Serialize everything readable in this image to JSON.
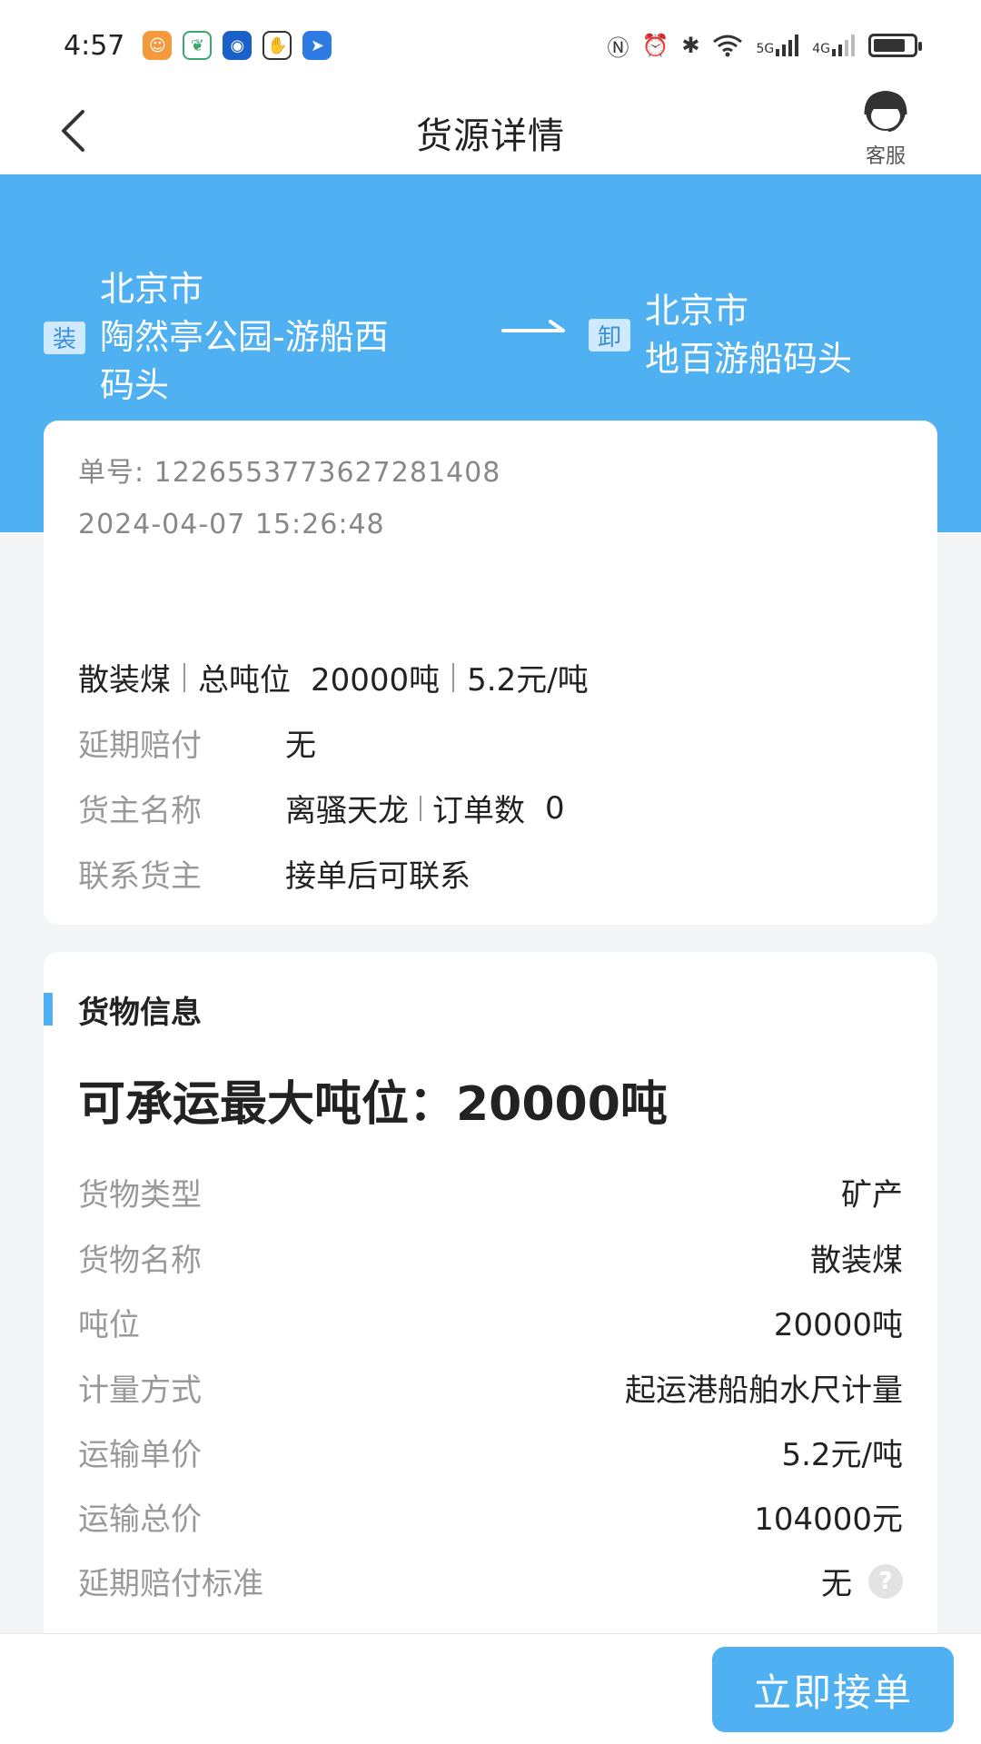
{
  "status": {
    "time": "4:57",
    "app_icons": [
      "taobao-icon",
      "leaf-app-icon",
      "robot-app-icon",
      "hand-app-icon",
      "arrow-app-icon"
    ],
    "system_icons": [
      "nfc-icon",
      "alarm-icon",
      "bluetooth-icon",
      "wifi-icon",
      "signal-5g-icon",
      "signal-4g-icon",
      "battery-icon"
    ],
    "net1": "5G",
    "net2": "4G"
  },
  "nav": {
    "title": "货源详情",
    "service_label": "客服"
  },
  "route": {
    "load_tag": "装",
    "from_city": "北京市",
    "from_place_line1": "陶然亭公园-游船西",
    "from_place_line2": "码头",
    "unload_tag": "卸",
    "to_city": "北京市",
    "to_place": "地百游船码头"
  },
  "order": {
    "number": "单号: 1226553773627281408",
    "time": "2024-04-07 15:26:48",
    "summary": {
      "cargo": "散装煤",
      "total_label": "总吨位",
      "total_value": "20000吨",
      "price": "5.2元/吨"
    },
    "rows": [
      {
        "label": "延期赔付",
        "value": "无"
      },
      {
        "label": "货主名称",
        "value": "离骚天龙",
        "extra_label": "订单数",
        "extra_value": "0"
      },
      {
        "label": "联系货主",
        "value": "接单后可联系"
      }
    ]
  },
  "cargo_info": {
    "section_title": "货物信息",
    "max_ton": "可承运最大吨位：20000吨",
    "rows": [
      {
        "label": "货物类型",
        "value": "矿产"
      },
      {
        "label": "货物名称",
        "value": "散装煤"
      },
      {
        "label": "吨位",
        "value": "20000吨"
      },
      {
        "label": "计量方式",
        "value": "起运港船舶水尺计量"
      },
      {
        "label": "运输单价",
        "value": "5.2元/吨"
      },
      {
        "label": "运输总价",
        "value": "104000元"
      },
      {
        "label": "延期赔付标准",
        "value": "无"
      }
    ]
  },
  "actions": {
    "accept_label": "立即接单"
  },
  "colors": {
    "primary": "#4fb0f2",
    "tag_bg": "#cfeaff",
    "label_gray": "#999999"
  }
}
